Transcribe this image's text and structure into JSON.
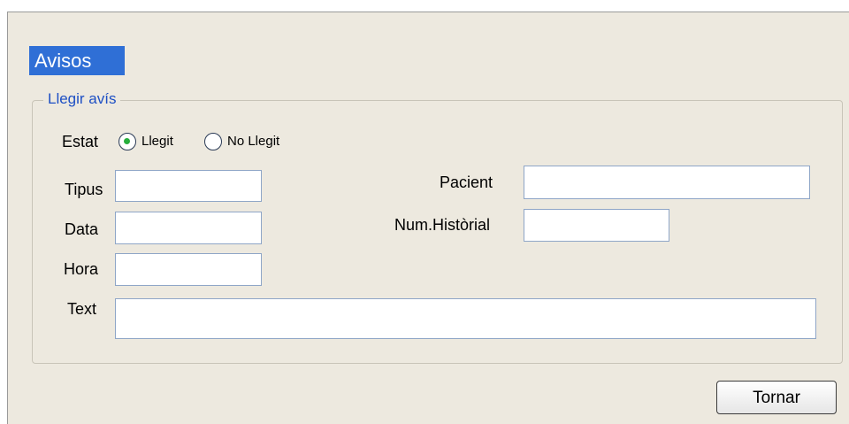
{
  "title": "Avisos",
  "group": {
    "legend": "Llegir avís"
  },
  "estat": {
    "label": "Estat",
    "options": [
      {
        "label": "Llegit",
        "selected": true
      },
      {
        "label": "No Llegit",
        "selected": false
      }
    ]
  },
  "fields": {
    "tipus": {
      "label": "Tipus",
      "value": ""
    },
    "data": {
      "label": "Data",
      "value": ""
    },
    "hora": {
      "label": "Hora",
      "value": ""
    },
    "text": {
      "label": "Text",
      "value": ""
    },
    "pacient": {
      "label": "Pacient",
      "value": ""
    },
    "num_historial": {
      "label": "Num.Històrial",
      "value": ""
    }
  },
  "buttons": {
    "back": "Tornar"
  },
  "colors": {
    "accent": "#2f6fd6",
    "background": "#ede9df",
    "radio_selected": "#27ae3c"
  }
}
